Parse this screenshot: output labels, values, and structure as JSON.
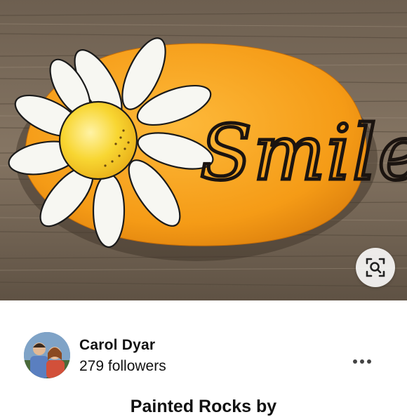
{
  "pin": {
    "image_alt": "Orange painted rock with white daisy and the word Smile",
    "rock_text": "Smile",
    "colors": {
      "rock_orange": "#f6a21b",
      "wood": "#7a6a58",
      "daisy_center": "#f6d02a"
    }
  },
  "visual_search": {
    "icon": "lens-search-icon"
  },
  "creator": {
    "name": "Carol Dyar",
    "followers": "279 followers",
    "more_icon": "ellipsis-icon"
  },
  "title": "Painted Rocks by"
}
